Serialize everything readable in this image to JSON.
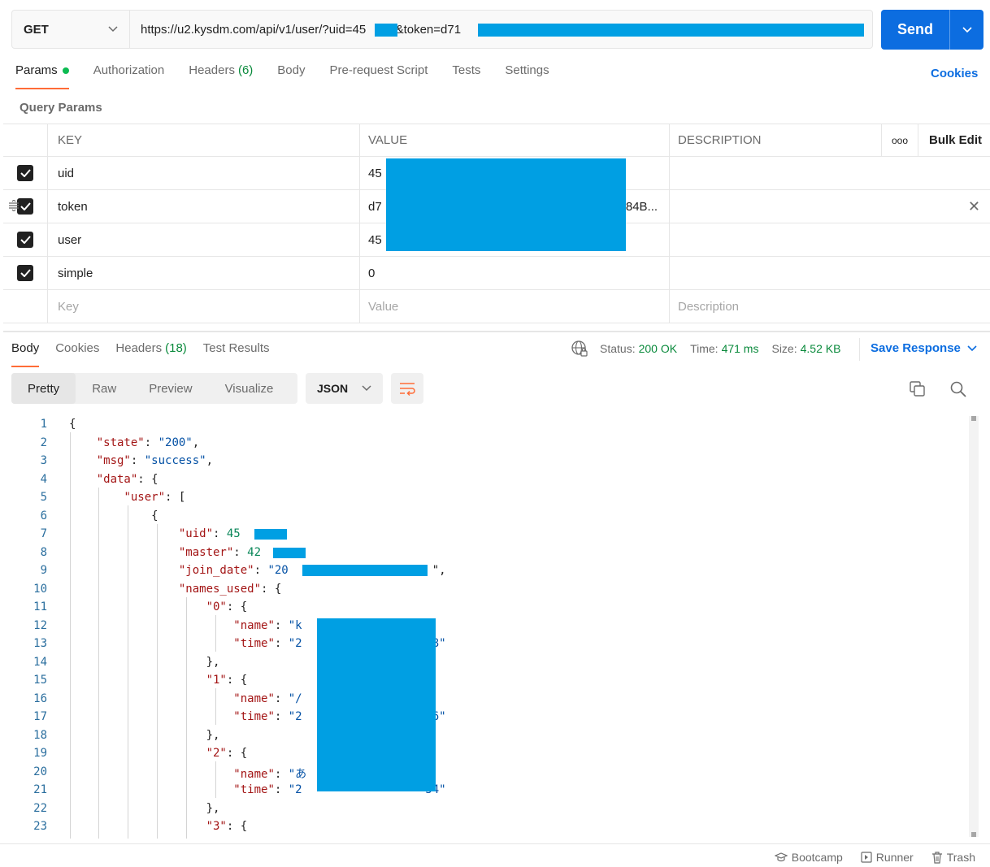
{
  "request": {
    "method": "GET",
    "url_prefix": "https://u2.kysdm.com/api/v1/user/?uid=45",
    "url_mid": "0&token=d71",
    "send_label": "Send"
  },
  "req_tabs": {
    "params": "Params",
    "authorization": "Authorization",
    "headers": "Headers",
    "headers_count": "(6)",
    "body": "Body",
    "prerequest": "Pre-request Script",
    "tests": "Tests",
    "settings": "Settings",
    "cookies": "Cookies"
  },
  "query_params": {
    "title": "Query Params",
    "headers": {
      "key": "KEY",
      "value": "VALUE",
      "description": "DESCRIPTION",
      "more": "ooo",
      "bulk_edit": "Bulk Edit"
    },
    "rows": [
      {
        "key": "uid",
        "value": "45"
      },
      {
        "key": "token",
        "value": "d7",
        "value_tail": "f84B..."
      },
      {
        "key": "user",
        "value": "45"
      },
      {
        "key": "simple",
        "value": "0"
      }
    ],
    "placeholders": {
      "key": "Key",
      "value": "Value",
      "description": "Description"
    }
  },
  "response": {
    "tabs": {
      "body": "Body",
      "cookies": "Cookies",
      "headers": "Headers",
      "headers_count": "(18)",
      "test_results": "Test Results"
    },
    "status_label": "Status:",
    "status_value": "200 OK",
    "time_label": "Time:",
    "time_value": "471 ms",
    "size_label": "Size:",
    "size_value": "4.52 KB",
    "save_response": "Save Response",
    "view_tabs": {
      "pretty": "Pretty",
      "raw": "Raw",
      "preview": "Preview",
      "visualize": "Visualize"
    },
    "format": "JSON"
  },
  "code": {
    "line_numbers": [
      "1",
      "2",
      "3",
      "4",
      "5",
      "6",
      "7",
      "8",
      "9",
      "10",
      "11",
      "12",
      "13",
      "14",
      "15",
      "16",
      "17",
      "18",
      "19",
      "20",
      "21",
      "22",
      "23"
    ],
    "state_key": "\"state\"",
    "state_val": "\"200\"",
    "msg_key": "\"msg\"",
    "msg_val": "\"success\"",
    "data_key": "\"data\"",
    "user_key": "\"user\"",
    "uid_key": "\"uid\"",
    "uid_val": "45",
    "master_key": "\"master\"",
    "master_val": "42",
    "join_key": "\"join_date\"",
    "join_val": "\"20",
    "names_key": "\"names_used\"",
    "k0": "\"0\"",
    "k1": "\"1\"",
    "k2": "\"2\"",
    "k3": "\"3\"",
    "name_key": "\"name\"",
    "time_key": "\"time\"",
    "name0": "\"k",
    "time0_head": "\"2",
    "time0_tail": "38\"",
    "name1": "\"/",
    "time1_head": "\"2",
    "time1_tail": "56\"",
    "name2": "\"あ",
    "time2_head": "\"2",
    "time2_tail": "54\""
  },
  "footer": {
    "bootcamp": "Bootcamp",
    "runner": "Runner",
    "trash": "Trash"
  },
  "colors": {
    "accent": "#ff6c37",
    "primary": "#0c6de0",
    "redaction": "#009fe3",
    "success": "#0a8a3c"
  }
}
